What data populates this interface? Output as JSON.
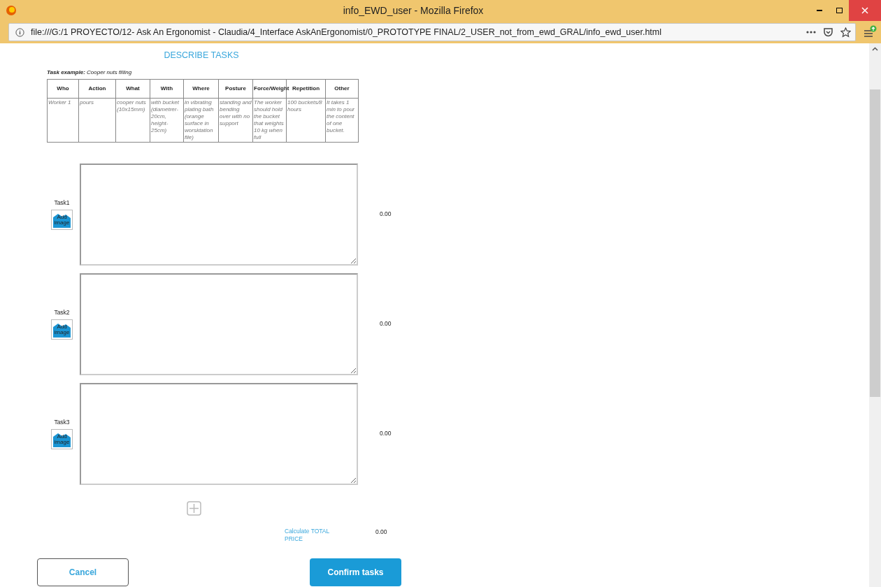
{
  "window": {
    "title": "info_EWD_user - Mozilla Firefox"
  },
  "address_bar": {
    "url": "file:///G:/1 PROYECTO/12- Ask An Ergonomist - Claudia/4_Interface AskAnErgonomist/0_PROTOTYPE FINAL/2_USER_not_from_ewd_GRAL/info_ewd_user.html"
  },
  "heading": "DESCRIBE TASKS",
  "example_caption": "**Task example:** Cooper nuts filling",
  "example_table": {
    "columns": [
      "Who",
      "Action",
      "What",
      "With",
      "Where",
      "Posture",
      "Force/Weight",
      "Repetition",
      "Other"
    ],
    "rows": [
      [
        "Worker 1",
        "pours",
        "cooper nuts (10x15mm)",
        "with bucket (diametrer-20cm, height-25cm)",
        "in vibrating plating bath (orange surface in worsktation file)",
        "standing and bending over with no support",
        "The worker should hold the bucket that weights 10 kg when full",
        "100 buckets/8 hours",
        "It takes 1 min to pour the content of one bucket."
      ]
    ]
  },
  "tasks": [
    {
      "label": "Task1",
      "image_button": "Add image",
      "price": "0.00"
    },
    {
      "label": "Task2",
      "image_button": "Add image",
      "price": "0.00"
    },
    {
      "label": "Task3",
      "image_button": "Add image",
      "price": "0.00"
    }
  ],
  "total": {
    "label": "Calculate TOTAL PRICE",
    "value": "0.00"
  },
  "buttons": {
    "cancel": "Cancel",
    "confirm": "Confirm tasks"
  }
}
